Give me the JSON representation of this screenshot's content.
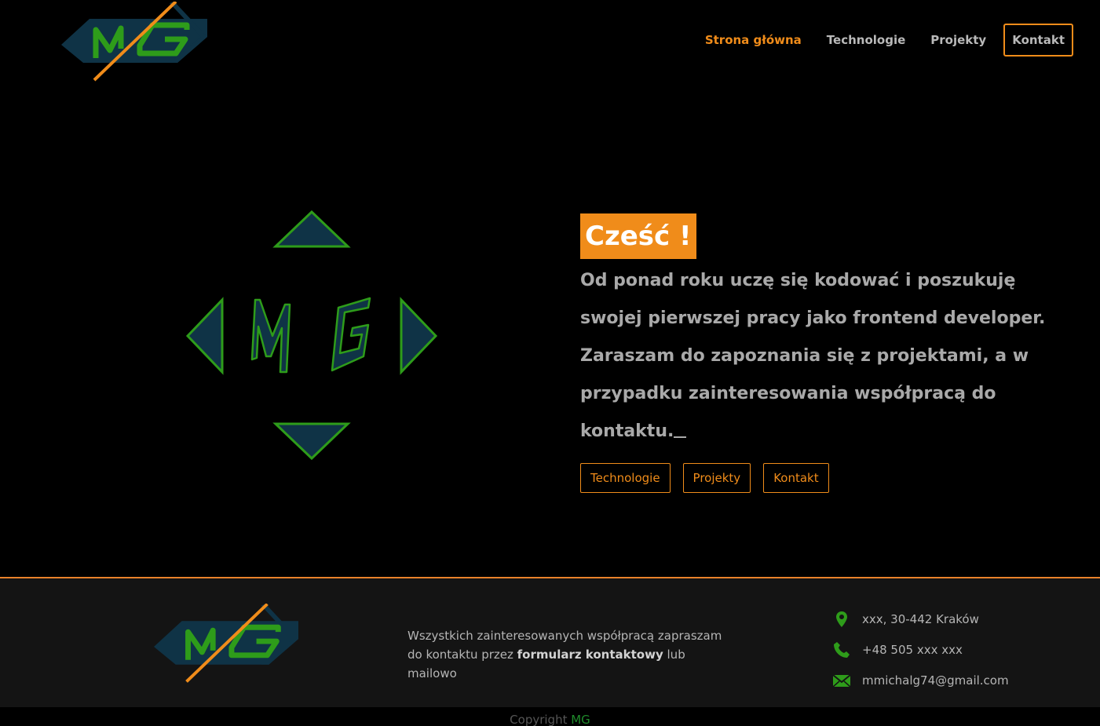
{
  "header": {
    "logo_label": "MG",
    "nav": [
      {
        "label": "Strona główna",
        "active": true
      },
      {
        "label": "Technologie"
      },
      {
        "label": "Projekty"
      },
      {
        "label": "Kontakt",
        "boxed": true
      }
    ]
  },
  "hero": {
    "greeting": "Cześć !",
    "intro": "Od ponad roku uczę się kodować i poszukuję swojej pierwszej pracy jako frontend developer. Zaraszam do zapoznania się z projektami, a w przypadku zainteresowania współpracą do kontaktu.",
    "buttons": [
      "Technologie",
      "Projekty",
      "Kontakt"
    ]
  },
  "footer": {
    "text_before": "Wszystkich zainteresowanych współpracą zapraszam do kontaktu przez ",
    "text_bold": "formularz kontaktowy",
    "text_after": " lub mailowo",
    "address": "xxx, 30-442 Kraków",
    "phone": "+48 505 xxx xxx",
    "email": "mmichalg74@gmail.com",
    "copyright_prefix": "Copyright ",
    "copyright_brand": "MG"
  },
  "colors": {
    "accent": "#f08c1a",
    "green": "#2e9c1a",
    "navy": "#0f3346",
    "background": "#000000",
    "footer_bg": "#141414"
  },
  "icons": [
    "location-pin-icon",
    "phone-icon",
    "envelope-icon"
  ]
}
